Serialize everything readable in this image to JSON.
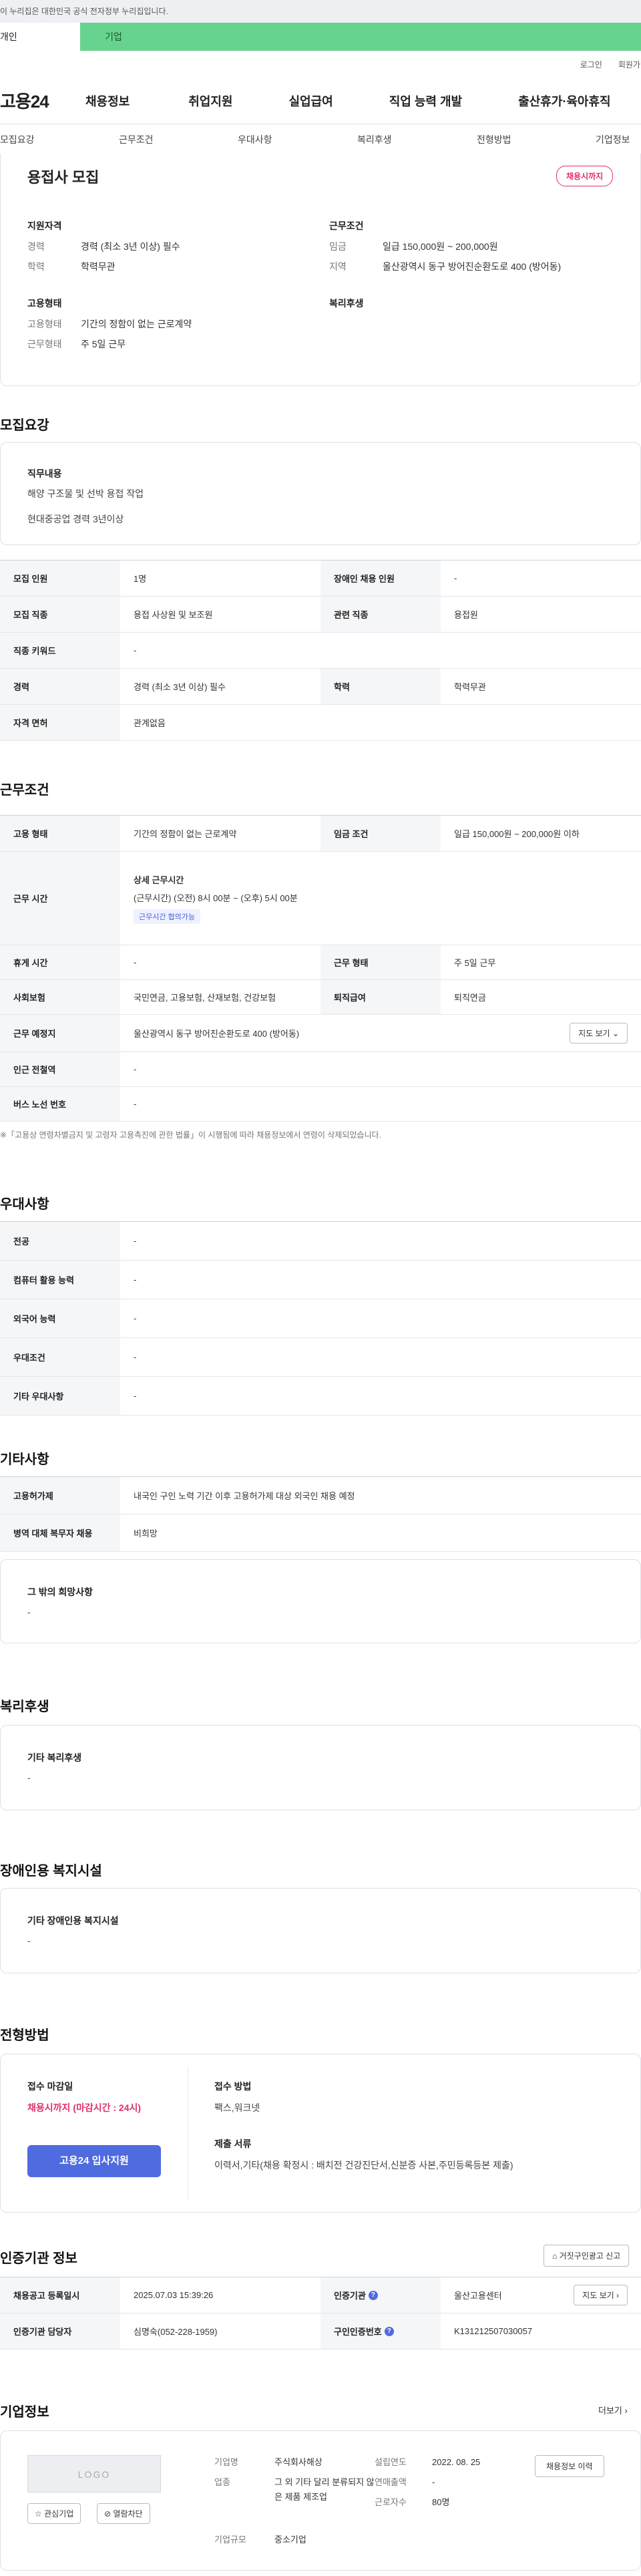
{
  "banner": "이 누리집은 대한민국 공식 전자정부 누리집입니다.",
  "user_tabs": [
    "개인",
    "기업"
  ],
  "top_links": [
    "로그인",
    "회원가입"
  ],
  "logo": "고용24",
  "gnb": [
    "채용정보",
    "취업지원",
    "실업급여",
    "직업 능력 개발",
    "출산휴가·육아휴직"
  ],
  "subnav": [
    "모집요강",
    "근무조건",
    "우대사항",
    "복리후생",
    "전형방법",
    "기업정보"
  ],
  "summary": {
    "title": "용접사 모집",
    "badge": "채용시까지",
    "qual_title": "지원자격",
    "qual": [
      {
        "k": "경력",
        "v": "경력 (최소 3년 이상) 필수"
      },
      {
        "k": "학력",
        "v": "학력무관"
      }
    ],
    "emp_title": "고용형태",
    "emp": [
      {
        "k": "고용형태",
        "v": "기간의 정함이 없는 근로계약"
      },
      {
        "k": "근무형태",
        "v": "주 5일 근무"
      }
    ],
    "cond_title": "근무조건",
    "cond": [
      {
        "k": "임금",
        "v": "일급 150,000원 ~ 200,000원"
      },
      {
        "k": "지역",
        "v": "울산광역시 동구 방어진순환도로 400 (방어동)"
      }
    ],
    "welfare_title": "복리후생"
  },
  "recruit": {
    "title": "모집요강",
    "duty_title": "직무내용",
    "duty": [
      "해양 구조물 및 선박 용접 작업",
      "현대중공업 경력 3년이상"
    ],
    "rows": [
      {
        "k1": "모집 인원",
        "v1": "1명",
        "k2": "장애인 채용 인원",
        "v2": "-"
      },
      {
        "k1": "모집 직종",
        "v1": "용접 사상원 및 보조원",
        "k2": "관련 직종",
        "v2": "용접원"
      },
      {
        "k1": "직종 키워드",
        "v1": "-"
      },
      {
        "k1": "경력",
        "v1": "경력 (최소 3년 이상) 필수",
        "k2": "학력",
        "v2": "학력무관"
      },
      {
        "k1": "자격 면허",
        "v1": "관계없음"
      }
    ]
  },
  "work": {
    "title": "근무조건",
    "emp_type_k": "고용 형태",
    "emp_type_v": "기간의 정함이 없는 근로계약",
    "wage_k": "임금 조건",
    "wage_v": "일급 150,000원 ~ 200,000원 이하",
    "hours_k": "근무 시간",
    "hours_sub": "상세 근무시간",
    "hours_v": "(근무시간) (오전) 8시 00분 ~ (오후) 5시 00분",
    "hours_chip": "근무시간 협의가능",
    "break_k": "휴게 시간",
    "break_v": "-",
    "form_k": "근무 형태",
    "form_v": "주 5일 근무",
    "ins_k": "사회보험",
    "ins_v": "국민연금, 고용보험, 산재보험, 건강보험",
    "ret_k": "퇴직급여",
    "ret_v": "퇴직연금",
    "place_k": "근무 예정지",
    "place_v": "울산광역시 동구 방어진순환도로 400 (방어동)",
    "map_btn": "지도 보기",
    "subway_k": "인근 전철역",
    "subway_v": "-",
    "bus_k": "버스 노선 번호",
    "bus_v": "-",
    "note": "※「고용상 연령차별금지 및 고령자 고용촉진에 관한 법률」이 시행됨에 따라 채용정보에서 연령이 삭제되었습니다."
  },
  "pref": {
    "title": "우대사항",
    "rows": [
      {
        "k": "전공",
        "v": "-"
      },
      {
        "k": "컴퓨터 활용 능력",
        "v": "-"
      },
      {
        "k": "외국어 능력",
        "v": "-"
      },
      {
        "k": "우대조건",
        "v": "-"
      },
      {
        "k": "기타 우대사항",
        "v": "-"
      }
    ]
  },
  "etc": {
    "title": "기타사항",
    "rows": [
      {
        "k": "고용허가제",
        "v": "내국인 구인 노력 기간 이후 고용허가제 대상 외국인 채용 예정"
      },
      {
        "k": "병역 대체 복무자 채용",
        "v": "비희망"
      }
    ],
    "hope_title": "그 밖의 희망사항",
    "hope_v": "-"
  },
  "welfare": {
    "title": "복리후생",
    "sub": "기타 복리후생",
    "v": "-"
  },
  "disabled": {
    "title": "장애인용 복지시설",
    "sub": "기타 장애인용 복지시설",
    "v": "-"
  },
  "selection": {
    "title": "전형방법",
    "deadline_k": "접수 마감일",
    "deadline_v": "채용시까지 (마감시간 : 24시)",
    "apply_btn": "고용24 입사지원",
    "method_k": "접수 방법",
    "method_v": "팩스,워크넷",
    "docs_k": "제출 서류",
    "docs_v": "이력서,기타(채용 확정시 : 배치전 건강진단서,신분증 사본,주민등록등본 제출)"
  },
  "cert": {
    "title": "인증기관 정보",
    "report_btn": "거짓구인광고 신고",
    "reg_k": "채용공고 등록일시",
    "reg_v": "2025.07.03 15:39:26",
    "org_k": "인증기관",
    "org_v": "울산고용센터",
    "map_btn": "지도 보기",
    "mgr_k": "인증기관 담당자",
    "mgr_v": "심명숙(052-228-1959)",
    "no_k": "구인인증번호",
    "no_v": "K131212507030057"
  },
  "company": {
    "title": "기업정보",
    "more": "더보기",
    "logo": "LOGO",
    "fav_btn": "관심기업",
    "block_btn": "열람차단",
    "name_k": "기업명",
    "name_v": "주식회사해상",
    "ind_k": "업종",
    "ind_v": "그 외 기타 달리 분류되지 않은 제품 제조업",
    "size_k": "기업규모",
    "size_v": "중소기업",
    "year_k": "설립연도",
    "year_v": "2022. 08. 25",
    "sales_k": "연매출액",
    "sales_v": "-",
    "emp_k": "근로자수",
    "emp_v": "80명",
    "history_btn": "채용정보 이력"
  }
}
